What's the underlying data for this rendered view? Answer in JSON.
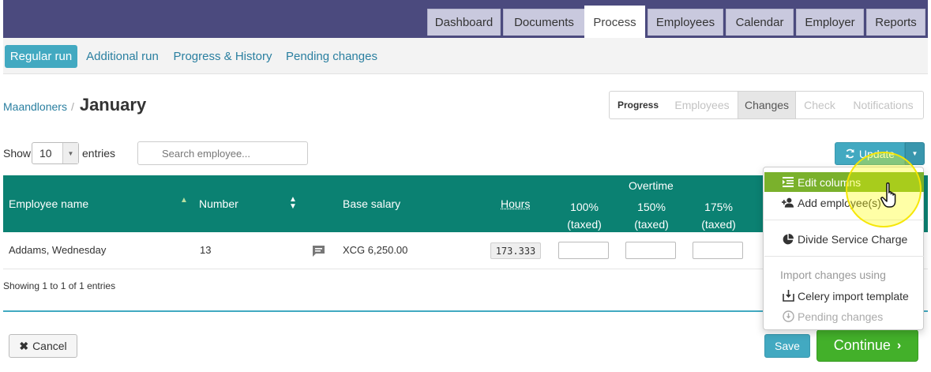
{
  "nav": {
    "tabs": [
      {
        "label": "Dashboard"
      },
      {
        "label": "Documents"
      },
      {
        "label": "Process"
      },
      {
        "label": "Employees"
      },
      {
        "label": "Calendar"
      },
      {
        "label": "Employer"
      },
      {
        "label": "Reports"
      }
    ],
    "active": "Process"
  },
  "subnav": {
    "items": [
      {
        "label": "Regular run"
      },
      {
        "label": "Additional run"
      },
      {
        "label": "Progress & History"
      },
      {
        "label": "Pending changes"
      }
    ],
    "active": "Regular run"
  },
  "breadcrumb": {
    "parent": "Maandloners",
    "separator": "/",
    "title": "January"
  },
  "steps": [
    {
      "label": "Progress"
    },
    {
      "label": "Employees"
    },
    {
      "label": "Changes"
    },
    {
      "label": "Check"
    },
    {
      "label": "Notifications"
    }
  ],
  "active_step": "Changes",
  "table_controls": {
    "show_label": "Show",
    "entries_value": "10",
    "entries_label": "entries",
    "search_placeholder": "Search employee..."
  },
  "update_button": {
    "label": "Update"
  },
  "table": {
    "headers": {
      "employee_name": "Employee name",
      "number": "Number",
      "base_salary": "Base salary",
      "hours": "Hours",
      "overtime_group": "Overtime",
      "ot1": "100%",
      "ot2": "150%",
      "ot3": "175%",
      "ot_sub": "(taxed)"
    },
    "rows": [
      {
        "employee_name": "Addams, Wednesday",
        "number": "13",
        "base_salary": "XCG 6,250.00",
        "hours": "173.333"
      }
    ],
    "info": "Showing 1 to 1 of 1 entries"
  },
  "dropdown": {
    "items": [
      {
        "label": "Edit columns",
        "icon": "columns-icon"
      },
      {
        "label": "Add employee(s)",
        "icon": "user-plus-icon"
      },
      {
        "label": "Divide Service Charge",
        "icon": "pie-chart-icon"
      }
    ],
    "import_header": "Import changes using",
    "import_items": [
      {
        "label": "Celery import template",
        "icon": "import-icon"
      },
      {
        "label": "Pending changes",
        "icon": "download-circle-icon"
      }
    ]
  },
  "footer": {
    "cancel": "Cancel",
    "save": "Save",
    "continue": "Continue"
  },
  "colors": {
    "topbar": "#4b4a7e",
    "table_header": "#0b8172",
    "accent": "#42a9c1",
    "continue_green": "#43b02a",
    "menu_highlight": "#7ab12c"
  }
}
